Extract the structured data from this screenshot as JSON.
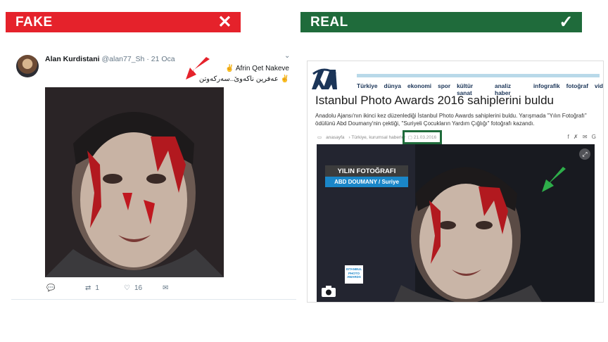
{
  "banners": {
    "fake_label": "FAKE",
    "fake_mark": "✕",
    "fake_color": "#e5222b",
    "real_label": "REAL",
    "real_mark": "✓",
    "real_color": "#1f6b3b"
  },
  "tweet": {
    "name": "Alan Kurdistani",
    "handle": "@alan77_Sh",
    "date": "· 21 Oca",
    "location_line1": "Afrin Qet Nakeve",
    "location_line2": "عەفرین ناکەوێ..سەرکەوتن",
    "location_icon": "victory-hand-icon",
    "retweets": "1",
    "likes": "16",
    "arrow_color": "#e5222b"
  },
  "article": {
    "logo": "AA",
    "nav": [
      "Türkiye",
      "dünya",
      "ekonomi",
      "spor",
      "kültür sanat",
      "analiz haber",
      "infografik",
      "fotoğraf",
      "vid"
    ],
    "title": "Istanbul Photo Awards 2016 sahiplerini buldu",
    "summary": "Anadolu Ajansı'nın ikinci kez düzenlediği İstanbul Photo Awards sahiplerini buldu. Yarışmada \"Yılın Fotoğrafı\" ödülünü Abd Doumany'nin çektiği, \"Suriyeli Çocukların Yardım Çığlığı\" fotoğrafı kazandı.",
    "crumb_home": "anasayfa",
    "crumb_section": "› Türkiye, kurumsal haberler",
    "date": "21.03.2016",
    "share": "f ✗ ✉ G",
    "award_title": "YILIN FOTOĞRAFI",
    "award_name": "ABD DOUMANY / Suriye",
    "ipa_logo": "ISTANBUL PHOTO AWARDS",
    "arrow_color": "#2eae4a"
  }
}
